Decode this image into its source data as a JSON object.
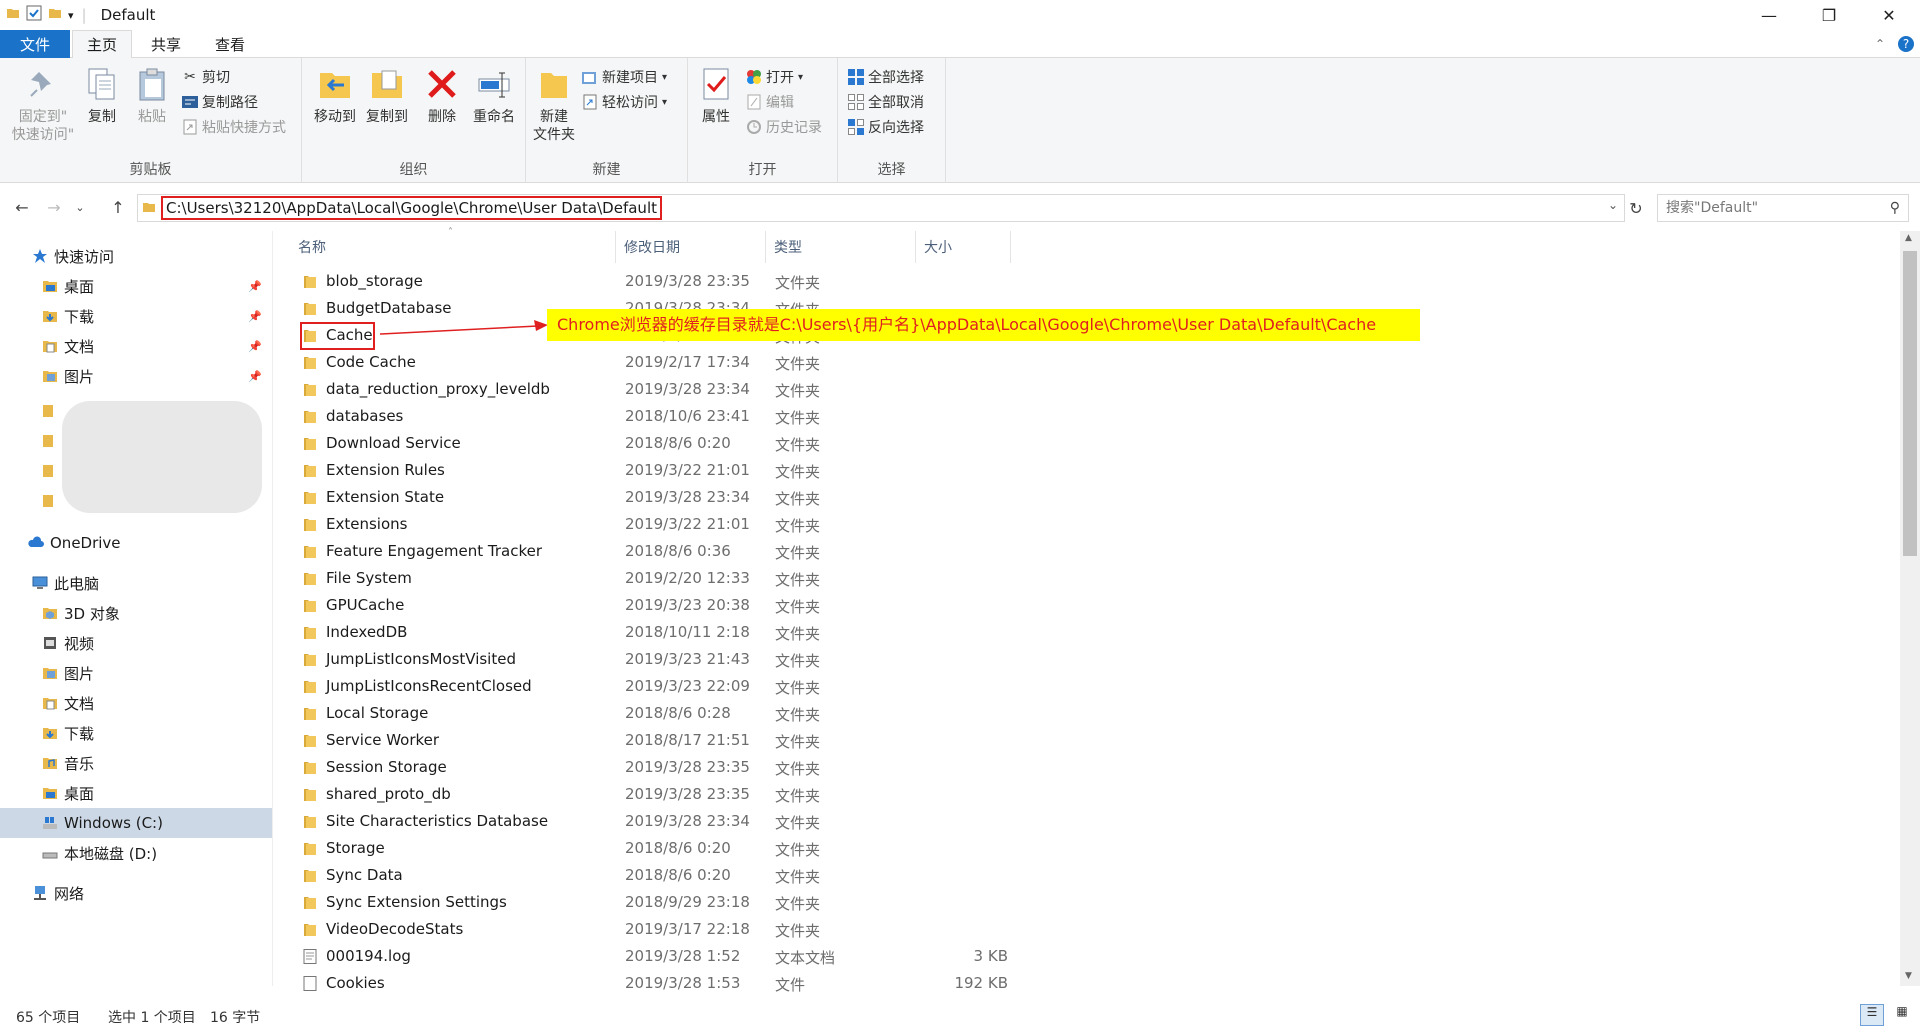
{
  "window": {
    "title": "Default",
    "minimize": "—",
    "maximize": "❐",
    "close": "✕"
  },
  "tabs": [
    "文件",
    "主页",
    "共享",
    "查看"
  ],
  "ribbon": {
    "clipboard": {
      "label": "剪贴板",
      "pin": "固定到\"\n快速访问\"",
      "copy": "复制",
      "paste": "粘贴",
      "cut": "剪切",
      "copy_path": "复制路径",
      "paste_shortcut": "粘贴快捷方式"
    },
    "organize": {
      "label": "组织",
      "move_to": "移动到",
      "copy_to": "复制到",
      "delete": "删除",
      "rename": "重命名"
    },
    "new": {
      "label": "新建",
      "new_folder": "新建\n文件夹",
      "new_item": "新建项目",
      "easy_access": "轻松访问"
    },
    "open": {
      "label": "打开",
      "properties": "属性",
      "open": "打开",
      "edit": "编辑",
      "history": "历史记录"
    },
    "select": {
      "label": "选择",
      "select_all": "全部选择",
      "select_none": "全部取消",
      "invert": "反向选择"
    }
  },
  "address": {
    "path": "C:\\Users\\32120\\AppData\\Local\\Google\\Chrome\\User Data\\Default",
    "search_placeholder": "搜索\"Default\""
  },
  "nav": {
    "quick_access": "快速访问",
    "quick_items": [
      "桌面",
      "下载",
      "文档",
      "图片"
    ],
    "onedrive": "OneDrive",
    "this_pc": "此电脑",
    "pc_items": [
      "3D 对象",
      "视频",
      "图片",
      "文档",
      "下载",
      "音乐",
      "桌面",
      "Windows (C:)",
      "本地磁盘 (D:)"
    ],
    "network": "网络"
  },
  "columns": {
    "name": "名称",
    "date": "修改日期",
    "type": "类型",
    "size": "大小"
  },
  "files": [
    {
      "name": "blob_storage",
      "date": "2019/3/28 23:35",
      "type": "文件夹",
      "size": "",
      "kind": "folder"
    },
    {
      "name": "BudgetDatabase",
      "date": "2019/3/28 23:34",
      "type": "文件夹",
      "size": "",
      "kind": "folder"
    },
    {
      "name": "Cache",
      "date": "2019/3/28 23:35",
      "type": "文件夹",
      "size": "",
      "kind": "folder"
    },
    {
      "name": "Code Cache",
      "date": "2019/2/17 17:34",
      "type": "文件夹",
      "size": "",
      "kind": "folder"
    },
    {
      "name": "data_reduction_proxy_leveldb",
      "date": "2019/3/28 23:34",
      "type": "文件夹",
      "size": "",
      "kind": "folder"
    },
    {
      "name": "databases",
      "date": "2018/10/6 23:41",
      "type": "文件夹",
      "size": "",
      "kind": "folder"
    },
    {
      "name": "Download Service",
      "date": "2018/8/6 0:20",
      "type": "文件夹",
      "size": "",
      "kind": "folder"
    },
    {
      "name": "Extension Rules",
      "date": "2019/3/22 21:01",
      "type": "文件夹",
      "size": "",
      "kind": "folder"
    },
    {
      "name": "Extension State",
      "date": "2019/3/28 23:34",
      "type": "文件夹",
      "size": "",
      "kind": "folder"
    },
    {
      "name": "Extensions",
      "date": "2019/3/22 21:01",
      "type": "文件夹",
      "size": "",
      "kind": "folder"
    },
    {
      "name": "Feature Engagement Tracker",
      "date": "2018/8/6 0:36",
      "type": "文件夹",
      "size": "",
      "kind": "folder"
    },
    {
      "name": "File System",
      "date": "2019/2/20 12:33",
      "type": "文件夹",
      "size": "",
      "kind": "folder"
    },
    {
      "name": "GPUCache",
      "date": "2019/3/23 20:38",
      "type": "文件夹",
      "size": "",
      "kind": "folder"
    },
    {
      "name": "IndexedDB",
      "date": "2018/10/11 2:18",
      "type": "文件夹",
      "size": "",
      "kind": "folder"
    },
    {
      "name": "JumpListIconsMostVisited",
      "date": "2019/3/23 21:43",
      "type": "文件夹",
      "size": "",
      "kind": "folder"
    },
    {
      "name": "JumpListIconsRecentClosed",
      "date": "2019/3/23 22:09",
      "type": "文件夹",
      "size": "",
      "kind": "folder"
    },
    {
      "name": "Local Storage",
      "date": "2018/8/6 0:28",
      "type": "文件夹",
      "size": "",
      "kind": "folder"
    },
    {
      "name": "Service Worker",
      "date": "2018/8/17 21:51",
      "type": "文件夹",
      "size": "",
      "kind": "folder"
    },
    {
      "name": "Session Storage",
      "date": "2019/3/28 23:35",
      "type": "文件夹",
      "size": "",
      "kind": "folder"
    },
    {
      "name": "shared_proto_db",
      "date": "2019/3/28 23:35",
      "type": "文件夹",
      "size": "",
      "kind": "folder"
    },
    {
      "name": "Site Characteristics Database",
      "date": "2019/3/28 23:34",
      "type": "文件夹",
      "size": "",
      "kind": "folder"
    },
    {
      "name": "Storage",
      "date": "2018/8/6 0:20",
      "type": "文件夹",
      "size": "",
      "kind": "folder"
    },
    {
      "name": "Sync Data",
      "date": "2018/8/6 0:20",
      "type": "文件夹",
      "size": "",
      "kind": "folder"
    },
    {
      "name": "Sync Extension Settings",
      "date": "2018/9/29 23:18",
      "type": "文件夹",
      "size": "",
      "kind": "folder"
    },
    {
      "name": "VideoDecodeStats",
      "date": "2019/3/17 22:18",
      "type": "文件夹",
      "size": "",
      "kind": "folder"
    },
    {
      "name": "000194.log",
      "date": "2019/3/28 1:52",
      "type": "文本文档",
      "size": "3 KB",
      "kind": "text"
    },
    {
      "name": "Cookies",
      "date": "2019/3/28 1:53",
      "type": "文件",
      "size": "192 KB",
      "kind": "file"
    }
  ],
  "annotation": "Chrome浏览器的缓存目录就是C:\\Users\\{用户名}\\AppData\\Local\\Google\\Chrome\\User Data\\Default\\Cache",
  "status": {
    "count": "65 个项目",
    "selected": "选中 1 个项目",
    "size": "16 字节"
  },
  "colors": {
    "accent": "#1a73c9",
    "folder": "#e8b94a",
    "highlight": "#ffff00",
    "annotation": "#e02020"
  }
}
